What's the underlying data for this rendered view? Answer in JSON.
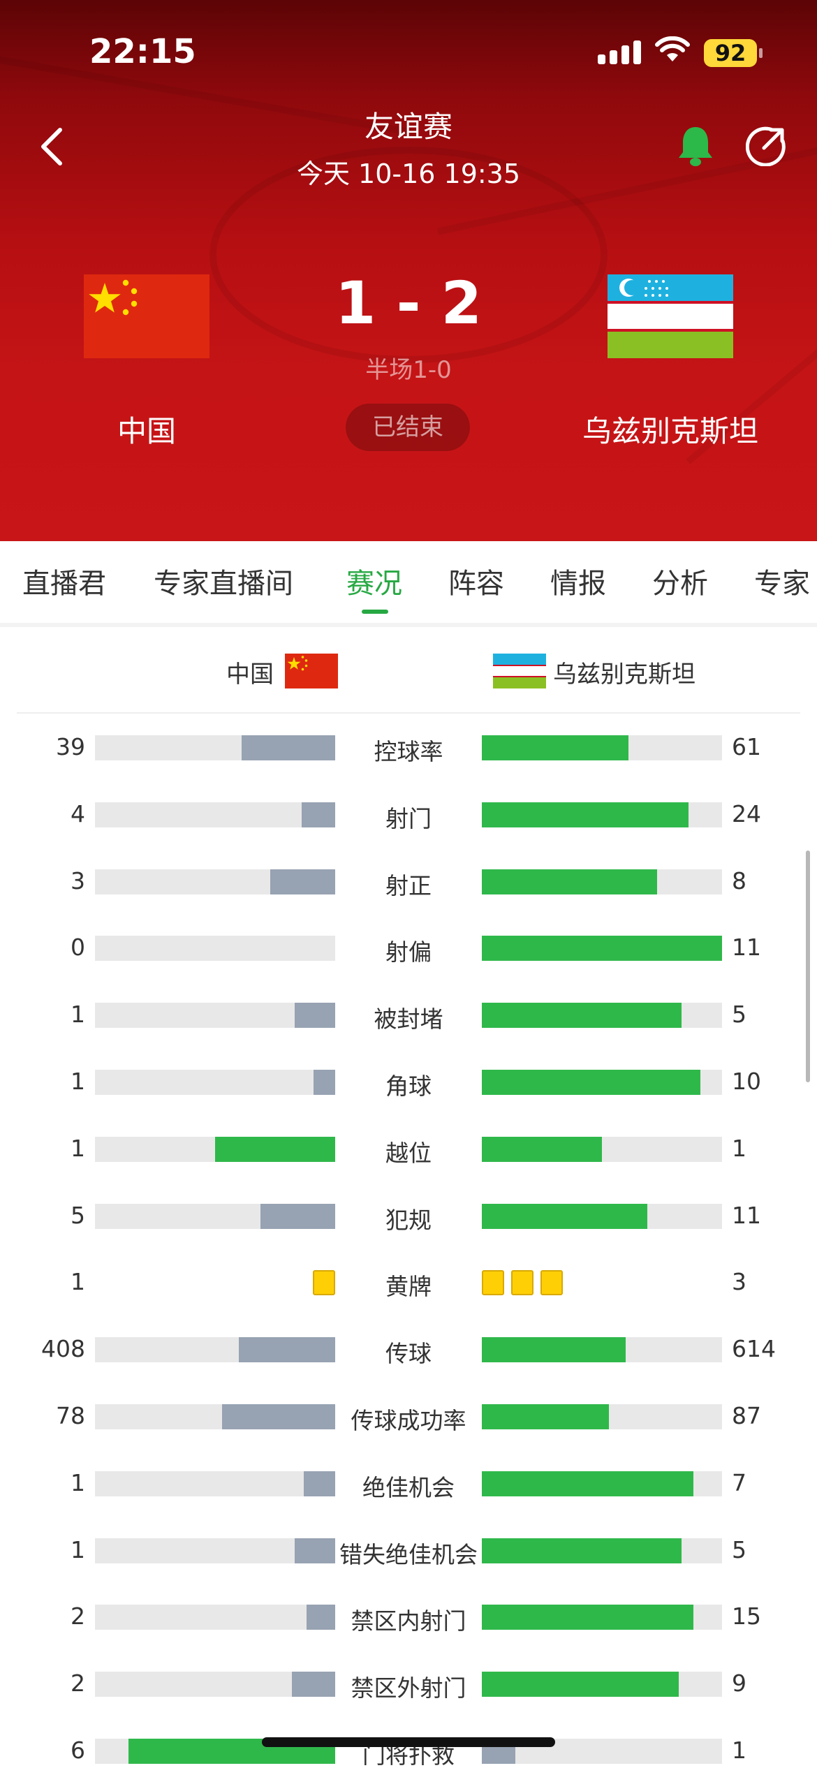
{
  "status_bar": {
    "time": "22:15",
    "battery": "92"
  },
  "match": {
    "competition": "友谊赛",
    "datetime": "今天 10-16 19:35",
    "home_team": "中国",
    "away_team": "乌兹别克斯坦",
    "score": "1 - 2",
    "halftime": "半场1-0",
    "status": "已结束"
  },
  "tabs": [
    {
      "label": "直播君",
      "active": false
    },
    {
      "label": "专家直播间",
      "active": false
    },
    {
      "label": "赛况",
      "active": true
    },
    {
      "label": "阵容",
      "active": false
    },
    {
      "label": "情报",
      "active": false
    },
    {
      "label": "分析",
      "active": false
    },
    {
      "label": "专家",
      "active": false
    }
  ],
  "stats_header": {
    "home": "中国",
    "away": "乌兹别克斯坦"
  },
  "stats": [
    {
      "label": "控球率",
      "home": "39",
      "away": "61",
      "home_fill": 0.39,
      "away_fill": 0.61,
      "home_color": "gray",
      "away_color": "green"
    },
    {
      "label": "射门",
      "home": "4",
      "away": "24",
      "home_fill": 0.14,
      "away_fill": 0.86,
      "home_color": "gray",
      "away_color": "green"
    },
    {
      "label": "射正",
      "home": "3",
      "away": "8",
      "home_fill": 0.27,
      "away_fill": 0.73,
      "home_color": "gray",
      "away_color": "green"
    },
    {
      "label": "射偏",
      "home": "0",
      "away": "11",
      "home_fill": 0.0,
      "away_fill": 1.0,
      "home_color": "gray",
      "away_color": "green"
    },
    {
      "label": "被封堵",
      "home": "1",
      "away": "5",
      "home_fill": 0.17,
      "away_fill": 0.83,
      "home_color": "gray",
      "away_color": "green"
    },
    {
      "label": "角球",
      "home": "1",
      "away": "10",
      "home_fill": 0.09,
      "away_fill": 0.91,
      "home_color": "gray",
      "away_color": "green"
    },
    {
      "label": "越位",
      "home": "1",
      "away": "1",
      "home_fill": 0.5,
      "away_fill": 0.5,
      "home_color": "green",
      "away_color": "green"
    },
    {
      "label": "犯规",
      "home": "5",
      "away": "11",
      "home_fill": 0.31,
      "away_fill": 0.69,
      "home_color": "gray",
      "away_color": "green"
    },
    {
      "label": "黄牌",
      "home": "1",
      "away": "3",
      "cards": true
    },
    {
      "label": "传球",
      "home": "408",
      "away": "614",
      "home_fill": 0.4,
      "away_fill": 0.6,
      "home_color": "gray",
      "away_color": "green"
    },
    {
      "label": "传球成功率",
      "home": "78",
      "away": "87",
      "home_fill": 0.47,
      "away_fill": 0.53,
      "home_color": "gray",
      "away_color": "green"
    },
    {
      "label": "绝佳机会",
      "home": "1",
      "away": "7",
      "home_fill": 0.13,
      "away_fill": 0.88,
      "home_color": "gray",
      "away_color": "green"
    },
    {
      "label": "错失绝佳机会",
      "home": "1",
      "away": "5",
      "home_fill": 0.17,
      "away_fill": 0.83,
      "home_color": "gray",
      "away_color": "green"
    },
    {
      "label": "禁区内射门",
      "home": "2",
      "away": "15",
      "home_fill": 0.12,
      "away_fill": 0.88,
      "home_color": "gray",
      "away_color": "green"
    },
    {
      "label": "禁区外射门",
      "home": "2",
      "away": "9",
      "home_fill": 0.18,
      "away_fill": 0.82,
      "home_color": "gray",
      "away_color": "green"
    },
    {
      "label": "门将扑救",
      "home": "6",
      "away": "1",
      "home_fill": 0.86,
      "away_fill": 0.14,
      "home_color": "green",
      "away_color": "gray"
    }
  ],
  "colors": {
    "accent_green": "#27a843",
    "bar_green": "#2fb84a",
    "bar_gray": "#97a2b2",
    "header_red": "#c51416",
    "yellow_card": "#ffcf06"
  }
}
